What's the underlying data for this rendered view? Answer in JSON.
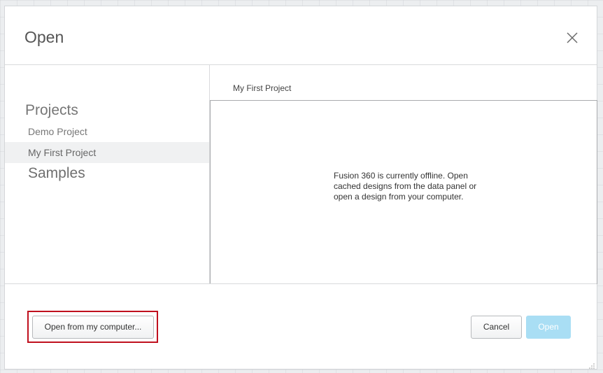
{
  "dialog": {
    "title": "Open"
  },
  "sidebar": {
    "projects_heading": "Projects",
    "items": [
      {
        "label": "Demo Project",
        "selected": false
      },
      {
        "label": "My First Project",
        "selected": true
      }
    ],
    "samples_heading": "Samples"
  },
  "content": {
    "tab_label": "My First Project",
    "message": "Fusion 360 is currently offline.  Open cached designs from the data panel or open a design from your computer."
  },
  "footer": {
    "open_from_computer_label": "Open from my computer...",
    "cancel_label": "Cancel",
    "open_label": "Open",
    "open_enabled": false
  },
  "colors": {
    "highlight_border": "#c0101e",
    "open_button_disabled": "#a9def4",
    "selected_item_bg": "#f0f1f2"
  },
  "icons": {
    "close": "close-icon",
    "resize": "resize-grip-icon"
  }
}
